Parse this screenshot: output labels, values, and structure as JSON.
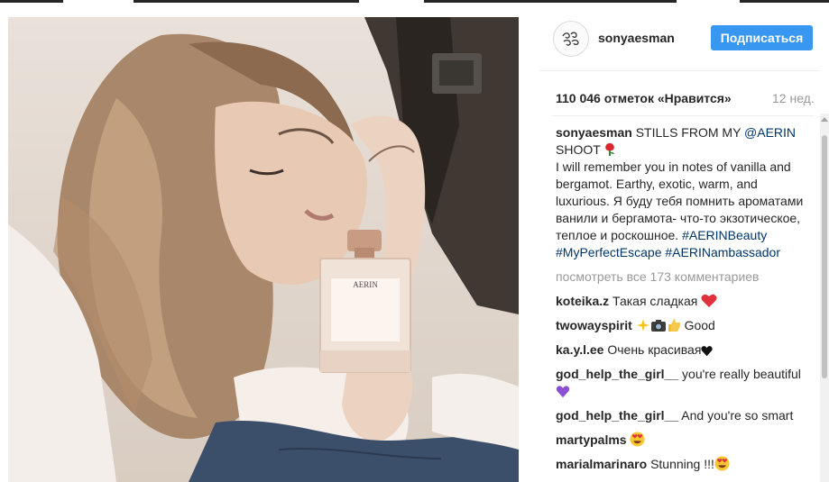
{
  "post": {
    "username": "sonyaesman",
    "follow_label": "Подписаться",
    "likes": "110 046 отметок «Нравится»",
    "time": "12 нед.",
    "caption": {
      "user": "sonyaesman",
      "text_1": " STILLS FROM MY ",
      "mention": "@AERIN",
      "text_2": " SHOOT ",
      "text_3": "I will remember you in notes of vanilla and bergamot. Earthy, exotic, warm, and luxurious. Я буду тебя помнить ароматами ванили и бергамота- что-то экзотическое, теплое и роскошное.",
      "tag_1": "#AERINBeauty",
      "tag_2": "#MyPerfectEscape",
      "tag_3": "#AERINambassador"
    },
    "view_all": "посмотреть все 173 комментариев",
    "comments": [
      {
        "user": "koteika.z",
        "text": "Такая сладкая "
      },
      {
        "user": "twowayspirit",
        "text": " Good"
      },
      {
        "user": "ka.y.l.ee",
        "text": "Очень красивая"
      },
      {
        "user": "god_help_the_girl__",
        "text": "you're really beautiful "
      },
      {
        "user": "god_help_the_girl__",
        "text": "And you're so smart"
      },
      {
        "user": "martypalms",
        "text": " "
      },
      {
        "user": "marialmarinaro",
        "text": "Stunning !!!"
      }
    ],
    "bottle_label": "AERIN"
  },
  "colors": {
    "accent": "#3897f0",
    "link": "#003569",
    "muted": "#999999",
    "text": "#262626"
  },
  "icons": [
    "rose-emoji",
    "heart-emoji",
    "sparkles-emoji",
    "camera-emoji",
    "thumbs-up-emoji",
    "black-heart-emoji",
    "purple-heart-emoji",
    "heart-eyes-emoji",
    "avatar-logo"
  ]
}
